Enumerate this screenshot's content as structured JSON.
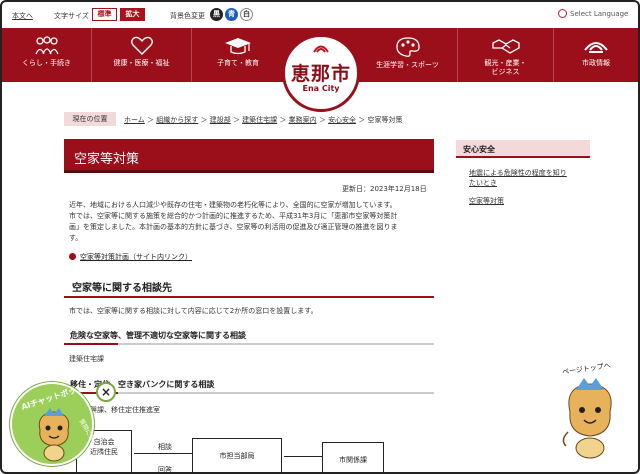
{
  "util": {
    "skip": "本文へ",
    "font_size_label": "文字サイズ",
    "font_std": "標準",
    "font_big": "拡大",
    "bg_label": "背景色変更",
    "bg_black": "黒",
    "bg_blue": "青",
    "bg_white": "白",
    "language": "Select Language"
  },
  "nav": {
    "items": [
      {
        "label": "くらし・手続き",
        "icon": "family-icon"
      },
      {
        "label": "健康・医療・福祉",
        "icon": "heart-icon"
      },
      {
        "label": "子育て・教育",
        "icon": "mortarboard-icon"
      },
      {
        "label": "生涯学習・スポーツ",
        "icon": "palette-icon"
      },
      {
        "label": "観光・産業・",
        "label2": "ビジネス",
        "icon": "handshake-icon"
      },
      {
        "label": "市政情報",
        "icon": "city-emblem-icon"
      }
    ],
    "logo_city": "恵那市",
    "logo_en": "Ena City"
  },
  "breadcrumb": {
    "here": "現在の位置",
    "items": [
      "ホーム",
      "組織から探す",
      "建設部",
      "建築住宅課",
      "業務案内",
      "安心安全",
      "空家等対策"
    ]
  },
  "main": {
    "title": "空家等対策",
    "updated": "更新日：2023年12月18日",
    "intro1": "近年、地域における人口減少や既存の住宅・建築物の老朽化等により、全国的に空家が増加しています。",
    "intro2": "市では、空家等に関する施策を総合的かつ計画的に推進するため、平成31年3月に「恵那市空家等対策計",
    "intro3": "画」を策定しました。本計画の基本的方針に基づき、空家等の利活用の促進及び適正管理の推進を図りま",
    "intro4": "す。",
    "plan_link": "空家等対策計画（サイト内リンク）",
    "h2": "空家等に関する相談先",
    "p2": "市では、空家等に関する相談に対して内容に応じて2か所の窓口を設置します。",
    "h3a": "危険な空家等、管理不適切な空家等に関する相談",
    "p3": "建築住宅課",
    "h3b": "移住・定住、空き家バンクに関する相談",
    "p4": "地域振興課、移住定住推進室",
    "flow": {
      "box1a": "自治会",
      "box1b": "近隣住民",
      "label_consult": "相談",
      "label_reply": "回答",
      "box2": "市担当部局",
      "box3": "市関係課"
    }
  },
  "sidebar": {
    "title": "安心安全",
    "link1a": "地震による危険性の程度を知り",
    "link1b": "たいとき",
    "link2": "空家等対策"
  },
  "widgets": {
    "chat_title": "AIチャットボット",
    "chat_sub": "質問に答えるんだっ",
    "close": "×",
    "pagetop": "ページトップへ"
  },
  "colors": {
    "brand": "#9b0f1a",
    "chat": "#9bcf5a"
  }
}
